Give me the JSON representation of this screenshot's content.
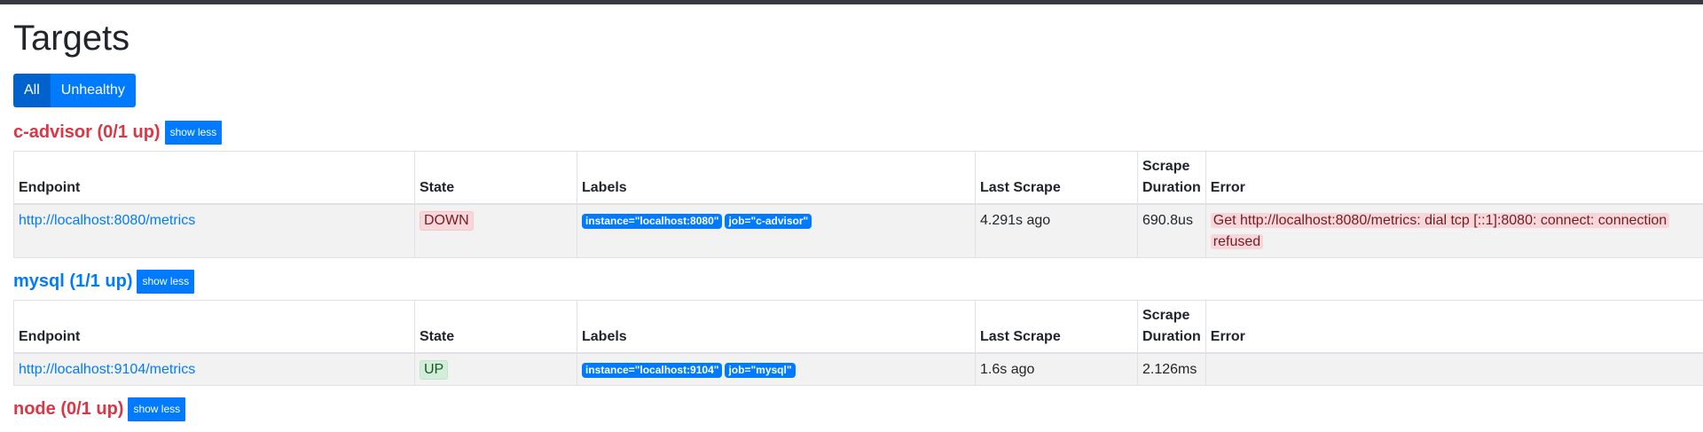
{
  "page": {
    "title": "Targets"
  },
  "filters": {
    "all_label": "All",
    "unhealthy_label": "Unhealthy"
  },
  "columns": {
    "endpoint": "Endpoint",
    "state": "State",
    "labels": "Labels",
    "last_scrape": "Last Scrape",
    "scrape_duration": "Scrape Duration",
    "error": "Error"
  },
  "jobs": [
    {
      "title": "c-advisor (0/1 up)",
      "toggle_label": "show less",
      "status_color": "#dc3545",
      "target": {
        "endpoint": "http://localhost:8080/metrics",
        "state": "DOWN",
        "labels": [
          "instance=\"localhost:8080\"",
          "job=\"c-advisor\""
        ],
        "last_scrape": "4.291s ago",
        "scrape_duration": "690.8us",
        "error": "Get http://localhost:8080/metrics: dial tcp [::1]:8080: connect: connection refused"
      }
    },
    {
      "title": "mysql (1/1 up)",
      "toggle_label": "show less",
      "status_color": "#007bff",
      "target": {
        "endpoint": "http://localhost:9104/metrics",
        "state": "UP",
        "labels": [
          "instance=\"localhost:9104\"",
          "job=\"mysql\""
        ],
        "last_scrape": "1.6s ago",
        "scrape_duration": "2.126ms",
        "error": ""
      }
    },
    {
      "title": "node (0/1 up)",
      "toggle_label": "show less",
      "status_color": "#dc3545"
    }
  ],
  "colors": {
    "primary": "#007bff",
    "danger": "#dc3545",
    "topbar": "#343a40"
  }
}
